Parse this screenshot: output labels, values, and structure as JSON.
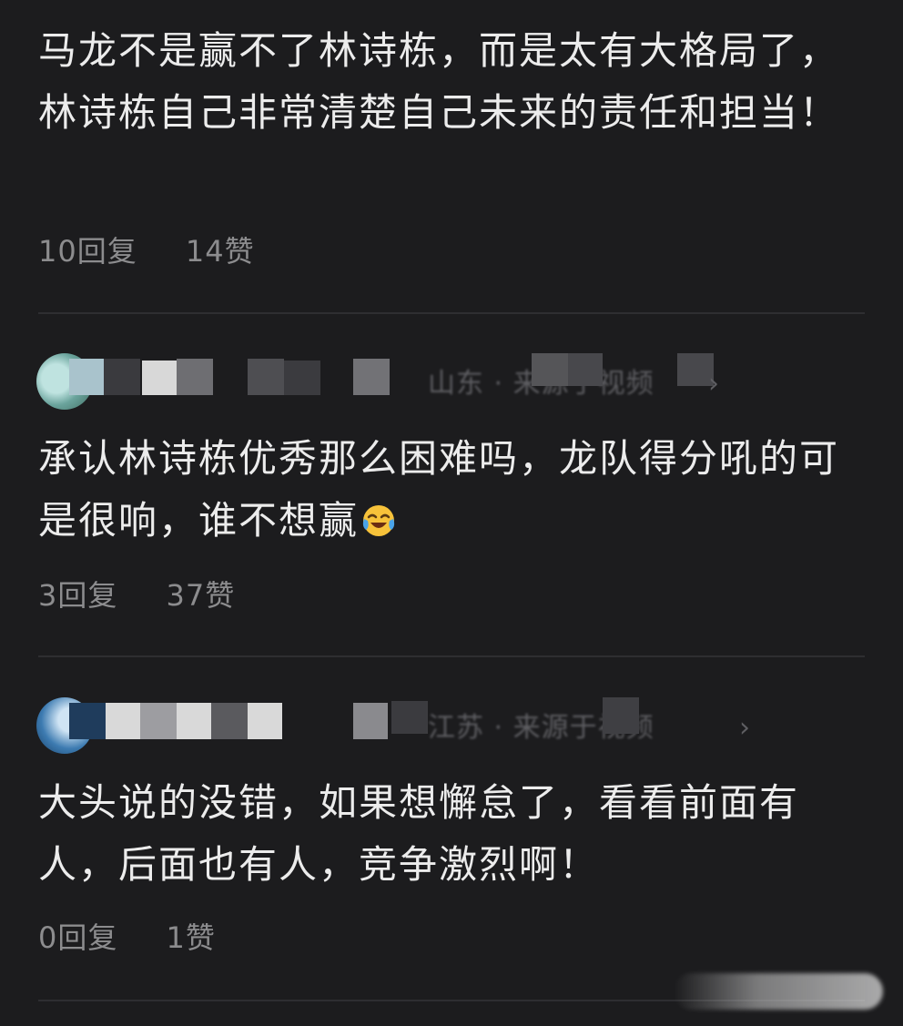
{
  "comments": [
    {
      "text": "马龙不是赢不了林诗栋，而是太有大格局了，林诗栋自己非常清楚自己未来的责任和担当！",
      "replies": "10回复",
      "likes": "14赞"
    },
    {
      "text": "承认林诗栋优秀那么困难吗，龙队得分吼的可是很响，谁不想赢",
      "emoji": "crying-laughing-emoji",
      "replies": "3回复",
      "likes": "37赞"
    },
    {
      "text": "大头说的没错，如果想懈怠了，看看前面有人，后面也有人，竞争激烈啊！",
      "replies": "0回复",
      "likes": "1赞"
    }
  ],
  "authors": [
    {
      "location_source": "山东 · 来源于视频"
    },
    {
      "location_source": "江苏 · 来源于视频"
    }
  ],
  "colors": {
    "background": "#1c1c1e",
    "text": "#ececec",
    "meta": "#8c8c8e",
    "divider": "#2e2e31"
  }
}
